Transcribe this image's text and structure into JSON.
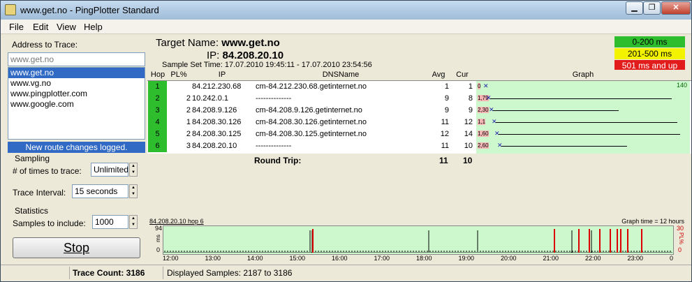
{
  "window": {
    "title": "www.get.no - PingPlotter Standard"
  },
  "menu": [
    "File",
    "Edit",
    "View",
    "Help"
  ],
  "sidebar": {
    "address_label": "Address to Trace:",
    "address_value": "www.get.no",
    "address_list": [
      "www.get.no",
      "www.vg.no",
      "www.pingplotter.com",
      "www.google.com"
    ],
    "route_banner": "New route changes logged.",
    "sampling_label": "Sampling",
    "times_label": "# of times to trace:",
    "times_value": "Unlimited",
    "interval_label": "Trace Interval:",
    "interval_value": "15 seconds",
    "statistics_label": "Statistics",
    "samples_label": "Samples to include:",
    "samples_value": "1000",
    "stop_label": "Stop"
  },
  "header": {
    "target_label": "Target Name:",
    "target_value": "www.get.no",
    "ip_label": "IP:",
    "ip_value": "84.208.20.10",
    "sample_label": "Sample Set Time:",
    "sample_value": "17.07.2010 19:45:11 - 17.07.2010 23:54:56"
  },
  "legend": [
    {
      "label": "0-200 ms",
      "color": "#2dbd2d"
    },
    {
      "label": "201-500 ms",
      "color": "#f3f300"
    },
    {
      "label": "501 ms and up",
      "color": "#e21b1b"
    }
  ],
  "columns": [
    "Hop",
    "PL%",
    "IP",
    "DNSName",
    "Avg",
    "Cur",
    "Graph"
  ],
  "hops": [
    {
      "hop": "1",
      "pl": "",
      "ip": "84.212.230.68",
      "dns": "cm-84.212.230.68.getinternet.no",
      "avg": "1",
      "cur": "1",
      "label": "0"
    },
    {
      "hop": "2",
      "pl": "2",
      "ip": "10.242.0.1",
      "dns": "--------------",
      "avg": "9",
      "cur": "8",
      "label": "1,79"
    },
    {
      "hop": "3",
      "pl": "2",
      "ip": "84.208.9.126",
      "dns": "cm-84.208.9.126.getinternet.no",
      "avg": "9",
      "cur": "9",
      "label": "2,30"
    },
    {
      "hop": "4",
      "pl": "1",
      "ip": "84.208.30.126",
      "dns": "cm-84.208.30.126.getinternet.no",
      "avg": "11",
      "cur": "12",
      "label": "1,1"
    },
    {
      "hop": "5",
      "pl": "2",
      "ip": "84.208.30.125",
      "dns": "cm-84.208.30.125.getinternet.no",
      "avg": "12",
      "cur": "14",
      "label": "1,60"
    },
    {
      "hop": "6",
      "pl": "3",
      "ip": "84.208.20.10",
      "dns": "--------------",
      "avg": "11",
      "cur": "10",
      "label": "2,60"
    }
  ],
  "graph": {
    "scale_max": "140"
  },
  "roundtrip": {
    "label": "Round Trip:",
    "avg": "11",
    "cur": "10"
  },
  "lower_graph": {
    "title": "84.208.20.10 hop 6",
    "graph_time": "Graph time = 12 hours",
    "y_max": "94",
    "y_min": "0",
    "y_unit": "ms",
    "pl_max": "30",
    "pl_min": "0",
    "pl_unit": "PL%",
    "x_labels": [
      "12:00",
      "13:00",
      "14:00",
      "15:00",
      "16:00",
      "17:00",
      "18:00",
      "19:00",
      "20:00",
      "21:00",
      "22:00",
      "23:00",
      "0"
    ]
  },
  "status": {
    "trace_count": "Trace Count: 3186",
    "displayed": "Displayed Samples: 2187 to 3186"
  }
}
